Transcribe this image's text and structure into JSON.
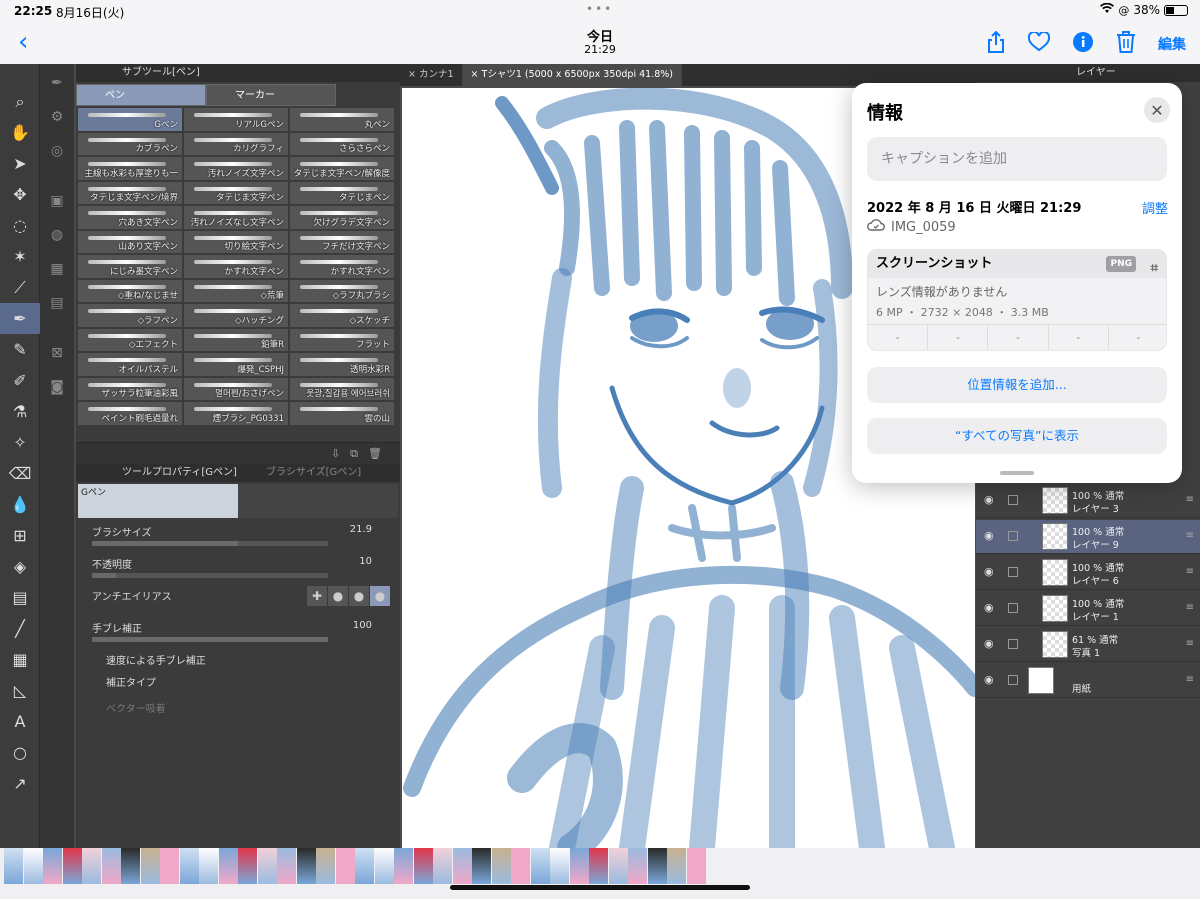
{
  "status": {
    "time": "22:25",
    "date": "8月16日(火)",
    "battery": "38%",
    "dots": "•••"
  },
  "nav": {
    "title": "今日",
    "subtitle": "21:29",
    "edit": "編集",
    "back": "‹"
  },
  "subtool": {
    "title": "サブツール[ペン]",
    "tab_pen": "ペン",
    "tab_marker": "マーカー",
    "brushes": [
      "Gペン",
      "リアルGペン",
      "丸ペン",
      "カブラペン",
      "カリグラフィ",
      "さらさらペン",
      "主線も水彩も厚塗りも一",
      "汚れノイズ文字ペン",
      "タテじま文字ペン/解像度",
      "タテじま文字ペン/境界",
      "タテじま文字ペン",
      "タテじまペン",
      "穴あき文字ペン",
      "汚れノイズなし文字ペン",
      "欠けグラデ文字ペン",
      "山あり文字ペン",
      "切り絵文字ペン",
      "フチだけ文字ペン",
      "にじみ墨文字ペン",
      "かすれ文字ペン",
      "かすれ文字ペン",
      "◇重ね/なじませ",
      "◇荒筆",
      "◇ラフ丸ブラシ",
      "◇ラフペン",
      "◇ハッチング",
      "◇スケッチ",
      "◇エフェクト",
      "鉛筆R",
      "フラット",
      "オイルパステル",
      "爆発_CSPHJ",
      "透明水彩R",
      "ザッサラ粒筆油彩風",
      "멸머펜/おさげペン",
      "웃광,질감용 에어브러쉬",
      "ペイント刷毛過量れ",
      "煙ブラシ_PG0331",
      "雲の山"
    ]
  },
  "toolprop": {
    "title": "ツールプロパティ[Gペン]",
    "title2": "ブラシサイズ[Gペン]",
    "preview_label": "Gペン",
    "brush_size_label": "ブラシサイズ",
    "brush_size_value": "21.9",
    "opacity_label": "不透明度",
    "opacity_value": "10",
    "aa_label": "アンチエイリアス",
    "stabilization_label": "手ブレ補正",
    "stabilization_value": "100",
    "speed_stab_label": "速度による手ブレ補正",
    "correction_type_label": "補正タイプ",
    "vector_snap_label": "ベクター吸着"
  },
  "doc_tabs": [
    "× カンナ1",
    "× Tシャツ1 (5000 x 6500px 350dpi 41.8%)"
  ],
  "layers": {
    "header": "レイヤー",
    "items": [
      {
        "pct": "100 % 通常",
        "name": "レイヤー 3",
        "selected": false
      },
      {
        "pct": "100 % 通常",
        "name": "レイヤー 9",
        "selected": true
      },
      {
        "pct": "100 % 通常",
        "name": "レイヤー 6",
        "selected": false
      },
      {
        "pct": "100 % 通常",
        "name": "レイヤー 1",
        "selected": false
      },
      {
        "pct": "61 % 通常",
        "name": "写真 1",
        "selected": false
      },
      {
        "pct": "",
        "name": "用紙",
        "selected": false
      }
    ]
  },
  "info": {
    "title": "情報",
    "caption_placeholder": "キャプションを追加",
    "datetime": "2022 年 8 月 16 日 火曜日 21:29",
    "adjust": "調整",
    "filename": "IMG_0059",
    "kind": "スクリーンショット",
    "format": "PNG",
    "lens": "レンズ情報がありません",
    "dims": "6 MP ・ 2732 × 2048 ・ 3.3 MB",
    "exif": [
      "-",
      "-",
      "-",
      "-",
      "-"
    ],
    "add_location": "位置情報を追加...",
    "show_all": "“すべての写真”に表示"
  },
  "colors": {
    "accent": "#0a7aff",
    "sketch": "#4a7fb8",
    "panel": "#3b3b3b"
  }
}
